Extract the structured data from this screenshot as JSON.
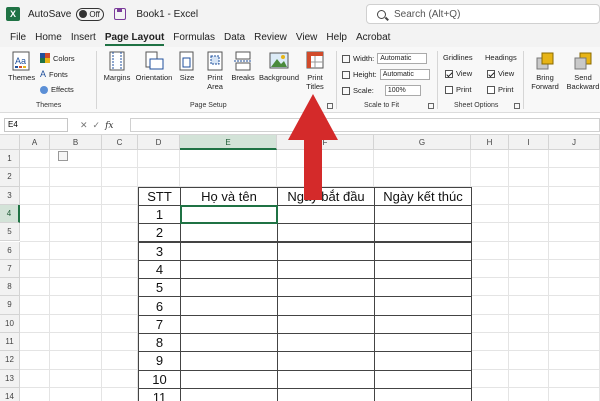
{
  "titlebar": {
    "autosave_label": "AutoSave",
    "autosave_state": "Off",
    "document_title": "Book1  -  Excel",
    "search_placeholder": "Search (Alt+Q)"
  },
  "menu": [
    "File",
    "Home",
    "Insert",
    "Page Layout",
    "Formulas",
    "Data",
    "Review",
    "View",
    "Help",
    "Acrobat"
  ],
  "menu_active": "Page Layout",
  "ribbon": {
    "themes": {
      "themes_label": "Themes",
      "colors_label": "Colors",
      "fonts_label": "Fonts",
      "effects_label": "Effects",
      "group_label": "Themes"
    },
    "page_setup": {
      "margins_label": "Margins",
      "orientation_label": "Orientation",
      "size_label": "Size",
      "print_area_label_1": "Print",
      "print_area_label_2": "Area",
      "breaks_label": "Breaks",
      "background_label": "Background",
      "print_titles_label_1": "Print",
      "print_titles_label_2": "Titles",
      "group_label": "Page Setup"
    },
    "scale_to_fit": {
      "width_label": "Width:",
      "width_value": "Automatic",
      "height_label": "Height:",
      "height_value": "Automatic",
      "scale_label": "Scale:",
      "scale_value": "100%",
      "group_label": "Scale to Fit"
    },
    "sheet_options": {
      "gridlines_label": "Gridlines",
      "headings_label": "Headings",
      "view_label": "View",
      "print_label": "Print",
      "group_label": "Sheet Options"
    },
    "arrange": {
      "bring_forward_label_1": "Bring",
      "bring_forward_label_2": "Forward",
      "send_backward_label_1": "Send",
      "send_backward_label_2": "Backward"
    }
  },
  "formula_bar": {
    "name_box": "E4",
    "fx_label": "fx",
    "formula_value": ""
  },
  "sheet": {
    "columns": [
      "A",
      "B",
      "C",
      "D",
      "E",
      "F",
      "G",
      "H",
      "I",
      "J"
    ],
    "rows": [
      "1",
      "2",
      "3",
      "4",
      "5",
      "6",
      "7",
      "8",
      "9",
      "10",
      "11",
      "12",
      "13",
      "14"
    ],
    "active_cell": "E4",
    "table_headers": [
      "STT",
      "Họ và tên",
      "Ngày bắt đầu",
      "Ngày kết thúc"
    ],
    "stt_values": [
      "1",
      "2",
      "3",
      "4",
      "5",
      "6",
      "7",
      "8",
      "9",
      "10",
      "11"
    ]
  },
  "colors": {
    "accent": "#1f7244",
    "arrow": "#d42a2a"
  }
}
